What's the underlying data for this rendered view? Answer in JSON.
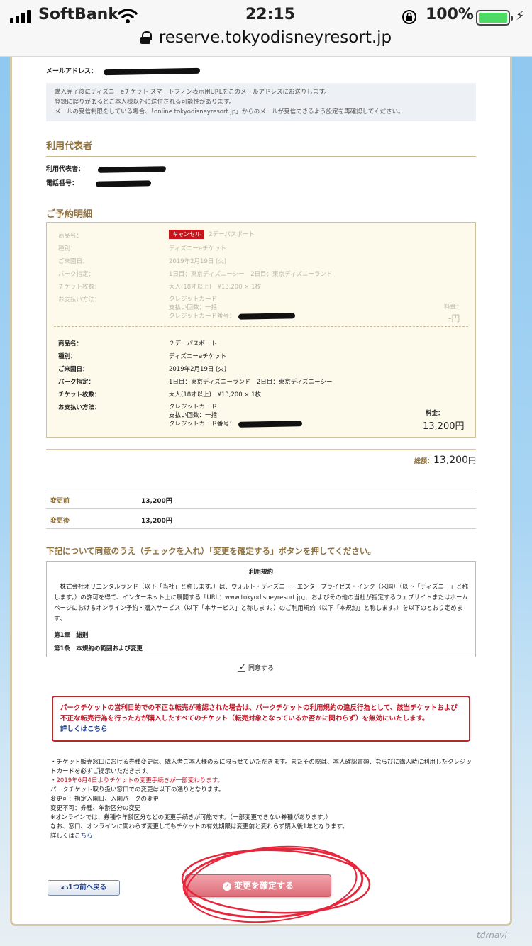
{
  "status_bar": {
    "carrier": "SoftBank",
    "time": "22:15",
    "battery_percent": "100%"
  },
  "browser": {
    "url": "reserve.tokyodisneyresort.jp"
  },
  "email_section": {
    "label": "メールアドレス：",
    "info_lines": [
      "購入完了後にディズニーeチケット スマートフォン表示用URLをこのメールアドレスにお送りします。",
      "登録に誤りがあるとご本人様以外に送付される可能性があります。",
      "メールの受信制限をしている場合、「online.tokyodisneyresort.jp」からのメールが受信できるよう設定を再確認してください。"
    ]
  },
  "representative": {
    "title": "利用代表者",
    "name_label": "利用代表者：",
    "phone_label": "電話番号："
  },
  "reservation": {
    "title": "ご予約明細",
    "cancel_badge": "キャンセル",
    "old": {
      "product_label": "商品名：",
      "product": "2デーパスポート",
      "type_label": "種別：",
      "type": "ディズニーeチケット",
      "date_label": "ご来園日：",
      "date": "2019年2月19日 (火)",
      "park_label": "パーク指定：",
      "park": "1日目：東京ディズニーシー　2日目：東京ディズニーランド",
      "count_label": "チケット枚数：",
      "count": "大人(18才以上)　¥13,200 × 1枚",
      "pay_label": "お支払い方法：",
      "pay_method": "クレジットカード",
      "pay_times": "支払い回数：一括",
      "card_label": "クレジットカード番号：",
      "fee_label": "料金：",
      "fee": "-円"
    },
    "new": {
      "product_label": "商品名：",
      "product": "２デーパスポート",
      "type_label": "種別：",
      "type": "ディズニーeチケット",
      "date_label": "ご来園日：",
      "date": "2019年2月19日 (火)",
      "park_label": "パーク指定：",
      "park": "1日目：東京ディズニーランド　2日目：東京ディズニーシー",
      "count_label": "チケット枚数：",
      "count": "大人(18才以上)　¥13,200 × 1枚",
      "pay_label": "お支払い方法：",
      "pay_method": "クレジットカード",
      "pay_times": "支払い回数：一括",
      "card_label": "クレジットカード番号：",
      "fee_label": "料金：",
      "fee": "13,200円"
    },
    "total_label": "総額：",
    "total_value": "13,200",
    "total_unit": "円"
  },
  "change": {
    "before_label": "変更前",
    "before_value": "13,200円",
    "after_label": "変更後",
    "after_value": "13,200円"
  },
  "agreement": {
    "heading": "下記について同意のうえ（チェックを入れ）「変更を確定する」ボタンを押してください。",
    "terms_title": "利用規約",
    "terms_body": "株式会社オリエンタルランド（以下「当社」と称します。）は、ウォルト・ディズニー・エンタープライゼズ・インク（米国）（以下「ディズニー」と称します。）の許可を得て、インターネット上に展開する「URL：www.tokyodisneyresort.jp」、およびその他の当社が指定するウェブサイトまたはホームページにおけるオンライン予約・購入サービス（以下「本サービス」と称します。）のご利用規約（以下「本規約」と称します。）を以下のとおり定めます。",
    "chapter": "第1章　総則",
    "article": "第1条　本規約の範囲および変更",
    "agree_label": "同意する"
  },
  "warning": {
    "text": "パークチケットの営利目的での不正な転売が確認された場合は、パークチケットの利用規約の違反行為として、該当チケットおよび不正な転売行為を行った方が購入したすべてのチケット（転売対象となっているか否かに関わらず）を無効にいたします。",
    "link": "詳しくはこちら"
  },
  "notes": {
    "line1": "・チケット販売窓口における券種変更は、購入者ご本人様のみに限らせていただきます。またその際は、本人確認書類、ならびに購入時に利用したクレジットカードを必ずご提示いただきます。",
    "line2": "・2019年6月4日よりチケットの変更手続きが一部変わります。",
    "line3": "パークチケット取り扱い窓口での変更は以下の通りとなります。",
    "line4": "変更可：指定入園日、入園パークの変更",
    "line5": "変更不可：券種、年齢区分の変更",
    "line6": "※オンラインでは、券種や年齢区分などの変更手続きが可能です。（一部変更できない券種があります。）",
    "line7": "なお、窓口、オンラインに関わらず変更してもチケットの有効期限は変更前と変わらず購入後1年となります。",
    "line8_prefix": "詳しくは",
    "line8_link": "こちら"
  },
  "buttons": {
    "back": "1つ前へ戻る",
    "confirm": "変更を確定する"
  },
  "colors": {
    "gold": "#8f7140",
    "warning_red": "#c0192a",
    "confirm_pink": "#dd6d79",
    "annotation_red": "#e8253a"
  },
  "watermark": "tdrnavi"
}
